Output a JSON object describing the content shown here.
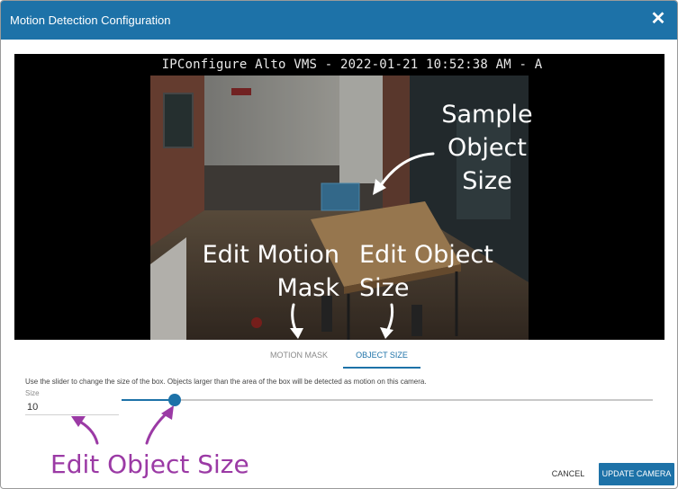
{
  "dialog": {
    "title": "Motion Detection Configuration",
    "close_icon": "close-icon"
  },
  "video": {
    "timestamp": "IPConfigure Alto VMS - 2022-01-21 10:52:38 AM - A"
  },
  "tabs": [
    {
      "label": "MOTION MASK",
      "active": false
    },
    {
      "label": "OBJECT SIZE",
      "active": true
    }
  ],
  "object_size": {
    "hint": "Use the slider to change the size of the box. Objects larger than the area of the box will be detected as motion on this camera.",
    "field_label": "Size",
    "value": "10",
    "slider_fraction": 0.1
  },
  "buttons": {
    "cancel": "CANCEL",
    "update": "UPDATE CAMERA"
  },
  "annotations": {
    "sample": [
      "Sample",
      "Object",
      "Size"
    ],
    "edit_mask": [
      "Edit Motion",
      "Mask"
    ],
    "edit_size": [
      "Edit Object",
      "Size"
    ],
    "edit_object_size": "Edit Object Size"
  },
  "colors": {
    "accent": "#1d72a8",
    "annotation_purple": "#9b3aa5",
    "sample_box": "#3f7fa8"
  }
}
